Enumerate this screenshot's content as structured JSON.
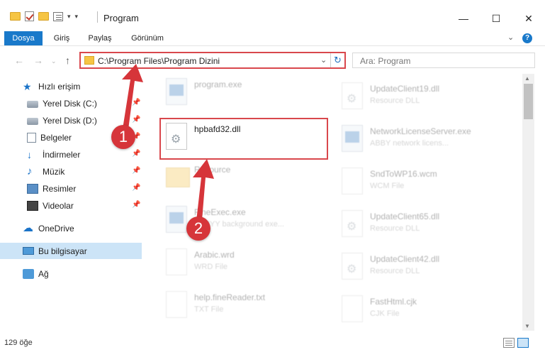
{
  "window": {
    "title": "Program"
  },
  "ribbon": {
    "tabs": [
      "Dosya",
      "Giriş",
      "Paylaş",
      "Görünüm"
    ],
    "help": "?"
  },
  "address": {
    "path": "C:\\Program Files\\Program Dizini",
    "search_placeholder": "Ara: Program"
  },
  "nav": {
    "items": [
      {
        "label": "Hızlı erişim"
      },
      {
        "label": "Yerel Disk (C:)"
      },
      {
        "label": "Yerel Disk (D:)"
      },
      {
        "label": "Belgeler"
      },
      {
        "label": "İndirmeler"
      },
      {
        "label": "Müzik"
      },
      {
        "label": "Resimler"
      },
      {
        "label": "Videolar"
      },
      {
        "label": "OneDrive"
      },
      {
        "label": "Bu bilgisayar"
      },
      {
        "label": "Ağ"
      }
    ]
  },
  "files": [
    {
      "name": "program.exe",
      "type": ""
    },
    {
      "name": "hpbafd32.dll",
      "type": ""
    },
    {
      "name": "Resource",
      "type": ""
    },
    {
      "name": "FineExec.exe",
      "type": "ABBYY background exe..."
    },
    {
      "name": "Arabic.wrd",
      "type": "WRD File"
    },
    {
      "name": "help.fineReader.txt",
      "type": "TXT File"
    },
    {
      "name": "UpdateClient19.dll",
      "type": "Resource DLL"
    },
    {
      "name": "NetworkLicenseServer.exe",
      "type": "ABBY network licens..."
    },
    {
      "name": "SndToWP16.wcm",
      "type": "WCM File"
    },
    {
      "name": "UpdateClient65.dll",
      "type": "Resource DLL"
    },
    {
      "name": "UpdateClient42.dll",
      "type": "Resource DLL"
    },
    {
      "name": "FastHtml.cjk",
      "type": "CJK File"
    }
  ],
  "status": {
    "count": "129 öğe"
  },
  "annotations": {
    "step1": "1",
    "step2": "2"
  },
  "colors": {
    "accent": "#1979ca",
    "highlight": "#d9474c",
    "badge": "#d6353a"
  }
}
